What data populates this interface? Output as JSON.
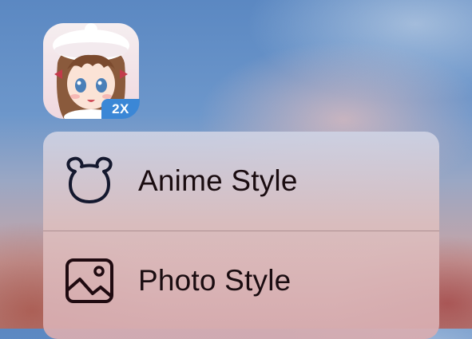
{
  "app": {
    "icon": "anime-girl-app-icon",
    "badge": "2X"
  },
  "menu": {
    "items": [
      {
        "label": "Anime Style",
        "icon": "bear-icon"
      },
      {
        "label": "Photo Style",
        "icon": "photo-icon"
      }
    ]
  },
  "colors": {
    "badge": "#3b87d6",
    "icon_stroke": "#14182e",
    "text": "#1a0c10"
  }
}
